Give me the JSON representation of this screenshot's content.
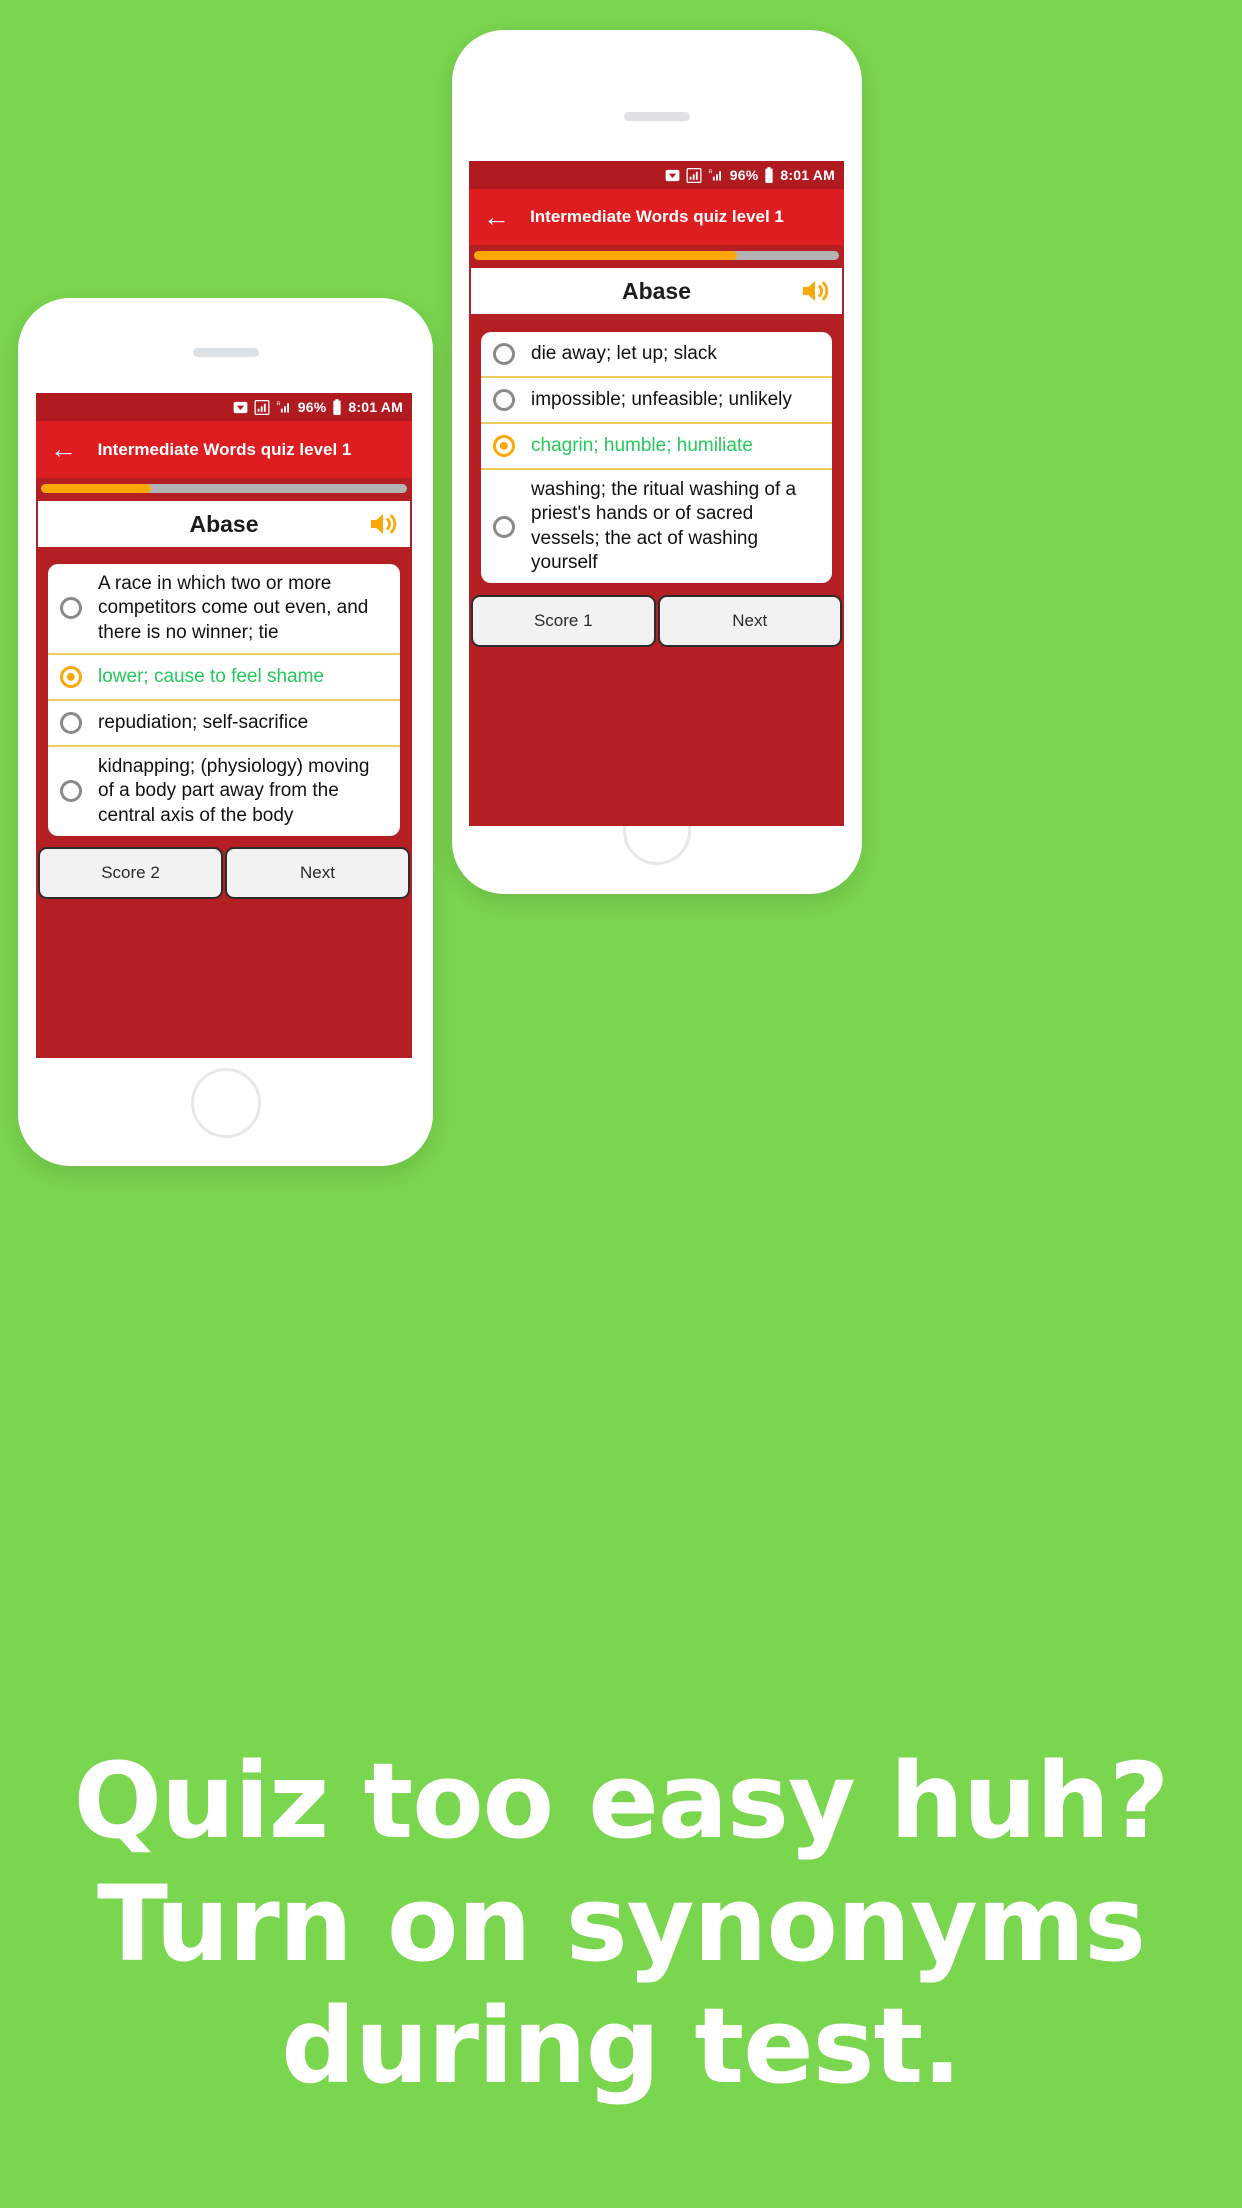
{
  "background_color": "#7BD64F",
  "theme": {
    "app_bar": "#DD1D20",
    "screen_bg": "#B41F23",
    "status_bar": "#B01B21",
    "accent_orange": "#FDA809",
    "correct_green": "#25C85B",
    "divider_gold": "#EDCB5E"
  },
  "status_bar": {
    "battery_percent": "96%",
    "time": "8:01 AM",
    "icons": [
      "message-icon",
      "signal-icon",
      "roaming-signal-icon",
      "battery-icon"
    ]
  },
  "app_bar": {
    "back_icon": "←",
    "title": "Intermediate Words quiz level 1"
  },
  "phone_a": {
    "progress_percent": 72,
    "word": "Abase",
    "speaker_icon": "volume-icon",
    "options": [
      {
        "text": "die away; let up; slack",
        "selected": false,
        "correct": false
      },
      {
        "text": "impossible; unfeasible; unlikely",
        "selected": false,
        "correct": false
      },
      {
        "text": "chagrin; humble; humiliate",
        "selected": true,
        "correct": true
      },
      {
        "text": "washing; the ritual washing of a priest's hands or of sacred vessels; the act of washing yourself",
        "selected": false,
        "correct": false
      }
    ],
    "score_label": "Score 1",
    "next_label": "Next"
  },
  "phone_b": {
    "progress_percent": 30,
    "word": "Abase",
    "speaker_icon": "volume-icon",
    "options": [
      {
        "text": "A race in which two or more competitors come out even, and there is no winner; tie",
        "selected": false,
        "correct": false
      },
      {
        "text": "lower; cause to feel shame",
        "selected": true,
        "correct": true
      },
      {
        "text": "repudiation; self-sacrifice",
        "selected": false,
        "correct": false
      },
      {
        "text": "kidnapping; (physiology) moving of a body part away from the central axis of the body",
        "selected": false,
        "correct": false
      }
    ],
    "score_label": "Score 2",
    "next_label": "Next"
  },
  "headline": {
    "line1": "Quiz too easy huh?",
    "line2": "Turn on synonyms",
    "line3": "during test."
  }
}
